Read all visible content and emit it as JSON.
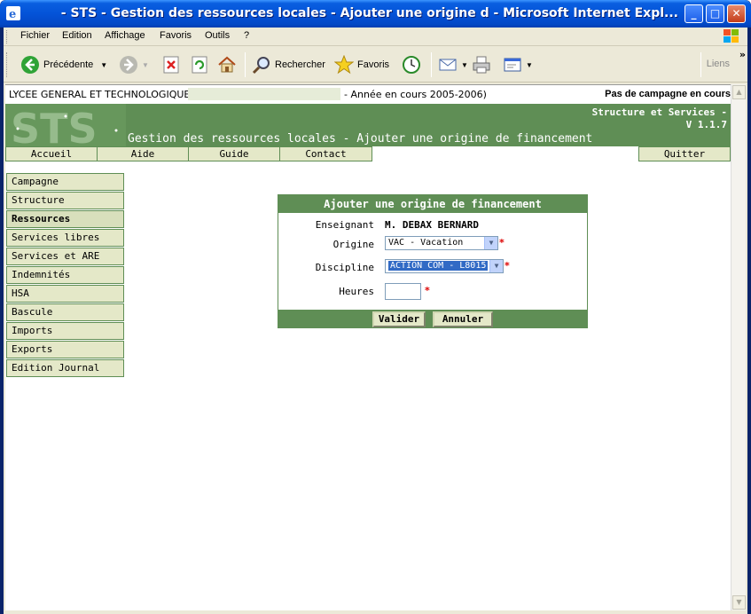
{
  "window": {
    "title": "- STS - Gestion des ressources locales - Ajouter une origine d - Microsoft Internet Expl...",
    "minimize": "_",
    "maximize": "□",
    "close": "✕"
  },
  "menu": [
    "Fichier",
    "Edition",
    "Affichage",
    "Favoris",
    "Outils",
    "?"
  ],
  "toolbar": {
    "back_label": "Précédente",
    "search_label": "Rechercher",
    "favorites_label": "Favoris",
    "links_label": "Liens",
    "more": "»"
  },
  "page": {
    "school": "LYCEE GENERAL ET TECHNOLOGIQUE",
    "year": "- Année en cours 2005-2006)",
    "campaign": "Pas de campagne en cours",
    "app_name_line1": "Structure et Services -",
    "app_name_line2": "V 1.1.7",
    "title": "Gestion des ressources locales - Ajouter une origine de financement",
    "logo_text": "STS"
  },
  "nav": {
    "accueil": "Accueil",
    "aide": "Aide",
    "guide": "Guide",
    "contact": "Contact",
    "quitter": "Quitter"
  },
  "sidebar": {
    "items": [
      {
        "label": "Campagne"
      },
      {
        "label": "Structure"
      },
      {
        "label": "Ressources"
      },
      {
        "label": "Services libres"
      },
      {
        "label": "Services et ARE"
      },
      {
        "label": "Indemnités"
      },
      {
        "label": "HSA"
      },
      {
        "label": "Bascule"
      },
      {
        "label": "Imports"
      },
      {
        "label": "Exports"
      },
      {
        "label": "Edition Journal"
      }
    ],
    "active": "Ressources"
  },
  "form": {
    "heading": "Ajouter une origine de financement",
    "enseignant_label": "Enseignant",
    "enseignant_value": "M. DEBAX BERNARD",
    "origine_label": "Origine",
    "origine_value": "VAC - Vacation",
    "discipline_label": "Discipline",
    "discipline_value": "ACTION COM - L8015",
    "heures_label": "Heures",
    "heures_value": "",
    "required_mark": "*",
    "valider": "Valider",
    "annuler": "Annuler"
  },
  "colors": {
    "brand_green": "#5f8e55",
    "tab_bg": "#e4e8c8",
    "xp_blue": "#0453d8"
  }
}
